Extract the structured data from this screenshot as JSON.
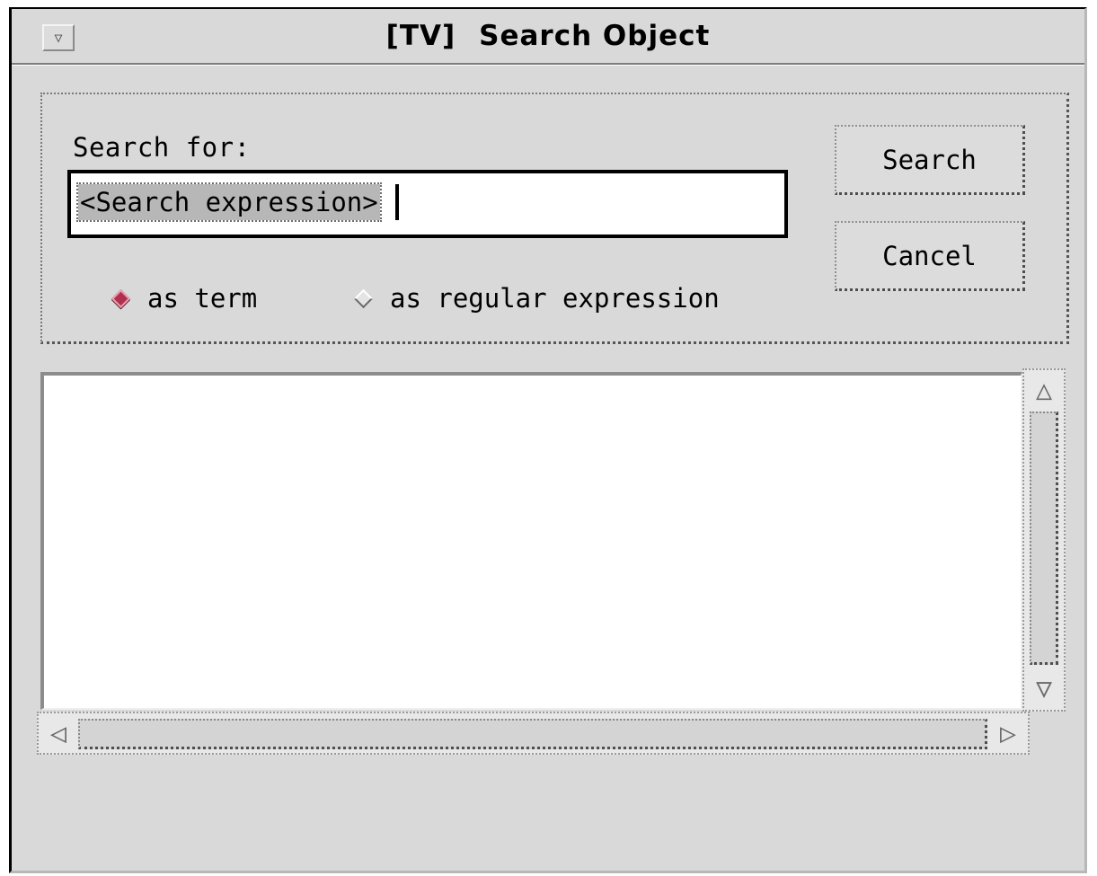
{
  "window": {
    "title_tag": "[TV]",
    "title": "Search Object",
    "menu_icon": "triangle-down-icon"
  },
  "search": {
    "label": "Search for:",
    "value": "<Search expression>",
    "selected_mode": "as term",
    "modes": [
      {
        "label": "as term",
        "selected": true
      },
      {
        "label": "as regular expression",
        "selected": false
      }
    ]
  },
  "buttons": {
    "search": "Search",
    "cancel": "Cancel"
  },
  "results": {
    "items": []
  },
  "colors": {
    "background": "#d9d9d9",
    "selected_radio": "#b03050",
    "field": "#ffffff"
  },
  "icons": {
    "scroll_up": "triangle-up-icon",
    "scroll_down": "triangle-down-icon",
    "scroll_left": "triangle-left-icon",
    "scroll_right": "triangle-right-icon"
  }
}
